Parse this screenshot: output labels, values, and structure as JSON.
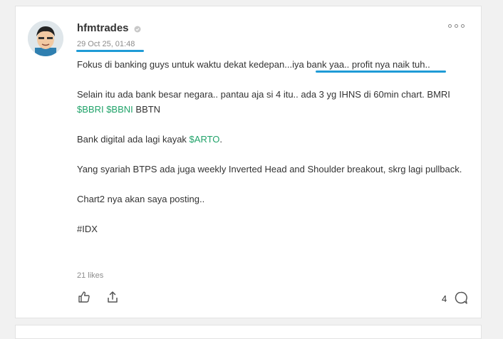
{
  "post": {
    "username": "hfmtrades",
    "timestamp": "29 Oct 25, 01:48",
    "paragraphs": {
      "p1": "Fokus di banking guys untuk waktu dekat kedepan...iya bank yaa.. profit nya naik tuh..",
      "p2_pre": "Selain itu ada bank besar negara.. pantau aja si 4 itu.. ada 3 yg IHNS di 60min chart. BMRI ",
      "p2_tag1": "$BBRI",
      "p2_tag2": "$BBNI",
      "p2_post": " BBTN",
      "p3_pre": "Bank digital ada lagi kayak ",
      "p3_tag": "$ARTO",
      "p3_post": ".",
      "p4": "Yang syariah BTPS ada juga weekly Inverted Head and Shoulder breakout, skrg lagi pullback.",
      "p5": "Chart2 nya akan saya posting..",
      "p6": "#IDX"
    },
    "likes_text": "21 likes",
    "comment_count": "4"
  },
  "icons": {
    "verified": "verified-icon",
    "more": "more-options-icon",
    "like": "thumbs-up-icon",
    "share": "share-icon",
    "comment": "comment-bubble-icon"
  },
  "colors": {
    "cashtag": "#21a36a",
    "highlight_underline": "#1f9bd6"
  }
}
